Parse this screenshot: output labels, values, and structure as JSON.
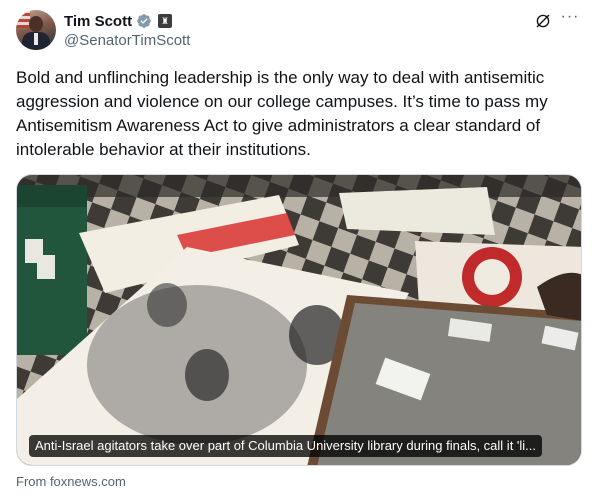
{
  "author": {
    "display_name": "Tim Scott",
    "handle": "@SenatorTimScott"
  },
  "icons": {
    "verified": "verified-check-icon",
    "government": "government-badge-icon",
    "grok": "grok-icon",
    "more": "more-horizontal-icon"
  },
  "tweet": {
    "text": "Bold and unflinching leadership is the only way to deal with antisemitic aggression and violence on our college campuses. It’s time to pass my Antisemitism Awareness Act to give administrators a clear standard of intolerable behavior at their institutions."
  },
  "card": {
    "caption": "Anti-Israel agitators take over part of Columbia University library during finals, call it 'li...",
    "source": "From foxnews.com"
  },
  "colors": {
    "text": "#0f1419",
    "secondary": "#536471",
    "verified": "#829aab"
  }
}
